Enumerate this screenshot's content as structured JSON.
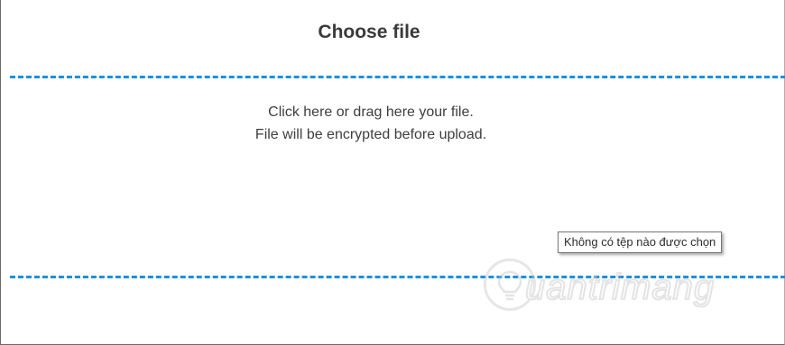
{
  "header": {
    "title": "Choose file"
  },
  "drop_zone": {
    "line1": "Click here or drag here your file.",
    "line2": "File will be encrypted before upload."
  },
  "tooltip": {
    "text": "Không có tệp nào được chọn"
  },
  "watermark": {
    "text": "uantrimang",
    "icon": "lightbulb-icon"
  },
  "colors": {
    "dash": "#1b8fe0",
    "text": "#3e3e3e",
    "frame": "#6b6b6b"
  }
}
